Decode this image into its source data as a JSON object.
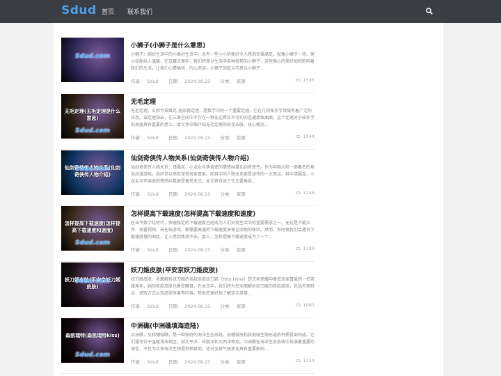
{
  "header": {
    "logo": "Sdud",
    "nav": [
      "首页",
      "联系我们"
    ]
  },
  "meta_labels": {
    "author": "作者:",
    "date": "日期:",
    "category": "分类:"
  },
  "posts": [
    {
      "title": "小狮子(小狮子是什么意思)",
      "excerpt": "小狮子：缤纷生活中的小美好生活中，总有一些小小的美好令人感到幸福满足。就像小狮子一样。尾小却能给人温暖，在这篇文章中，我们将探讨生活中各种各样的小狮子，这些微小的美好如何影响着我们的生活，让我们心情愉悦，内心充实。小狮子的定义与意义小狮子...",
      "author": "Sdud",
      "date": "2024.08.23",
      "category": "资源",
      "views": "1596",
      "thumb_logo": "Sdud.com",
      "thumb_caption": ""
    },
    {
      "title": "无毛定理",
      "excerpt": "无毛定理，又称为诺维克-施奈德定理，是数学中的一个重要定理。它在几何拓扑学领域有着广泛的应用。该定理指出，在三维空间中不存在一种无边界且不可约的连通紧致曲面。这个定理对于拓扑学的发展具有重要的意义。本文将详细介绍无毛定理的来龙去脉、核心概念...",
      "author": "Sdud",
      "date": "2024.08.23",
      "category": "资源",
      "views": "1044",
      "thumb_logo": "Sdud.com",
      "thumb_caption": "无毛定理(无毛定理是什么意思)"
    },
    {
      "title": "仙剑奇侠传人物关系(仙剑奇侠传人物介绍)",
      "excerpt": "仙剑奇侠传人物关系：请霸克、小龙女与李逍遥的情感纠葛仙剑奇侠传。作为中国大陆一部著名的角色扮演游戏，自问世以来就深受玩家喜爱。而其中的人物关系更是该作的一大亮点。其中请霸克、小龙女与李逍遥的情感纠葛更是备受关注。本文将详述三位主要角色...",
      "author": "Sdud",
      "date": "2024.08.23",
      "category": "资源",
      "views": "1248",
      "thumb_logo": "Sdud.com",
      "thumb_caption": "仙剑奇侠传人物关系(仙剑奇侠传人物介绍)"
    },
    {
      "title": "怎样提高下载速度(怎样提高下载速度和速度)",
      "excerpt": "在当今数字化时代，快速稳定的下载速度已经成为人们日常生活中的重要需求之一。无论是下载文件、观看视频、玩在线游戏，都需要高速的下载速度来保证流畅的体验。然而，有时候我们会遇到下载速度慢的困扰，让人感到焦虑不安。那么，怎样提高下载速度成为了一个...",
      "author": "Sdud",
      "date": "2024.08.23",
      "category": "资源",
      "views": "1189",
      "thumb_logo": "Sdud.com",
      "thumb_caption": "怎样提高下载速度(怎样提高下载速度和速度)"
    },
    {
      "title": "妖刀姬皮肤(平安京妖刀姬皮肤)",
      "excerpt": "妖刀姬皮肤：全面解析妖刀姬的各款皮肤妖刀姬（Yoto Hime）是王者荣耀中备受玩家喜爱的一名英雄角色，她的各款皮肤也备受瞩目。在本文中，我们将为您全面解析妖刀姬的各款皮肤，包括外观特点、获取方式以及皮肤效果等内容，帮助您更好地了解这位英雄...",
      "author": "Sdud",
      "date": "2024.08.23",
      "category": "资源",
      "views": "1083",
      "thumb_logo": "Sdud.com",
      "thumb_caption": "妖刀姬皮肤(平安京妖刀姬皮肤)"
    },
    {
      "title": "中洲礁(中洲礁填海造陆)",
      "excerpt": "中洲礁，又称珊瑚礁，是一种独特的海洋生态系统，由珊瑚虫和其他微生物形成的钙质骨架构成。它们通常位于温暖浅海地区，如太平洋、印度洋和大西洋等地。中洲礁在海洋生态系统中扮演着重要的角色，不仅为众多海洋生物提供栖息地，还对全球气候变化具有重要影响...",
      "author": "Sdud",
      "date": "2024.08.23",
      "category": "资源",
      "views": "1224",
      "thumb_logo": "Sdud.com",
      "thumb_caption": "森凯瑞特(森凯瑞特kiss)"
    }
  ],
  "colors": {
    "topbar": "#3a3d44",
    "logo": "#4da0e8",
    "thumbs": [
      "#2a2350",
      "#2b1f14",
      "#0d3560",
      "#3a2a1a",
      "#1a1016",
      "#12070a"
    ]
  }
}
